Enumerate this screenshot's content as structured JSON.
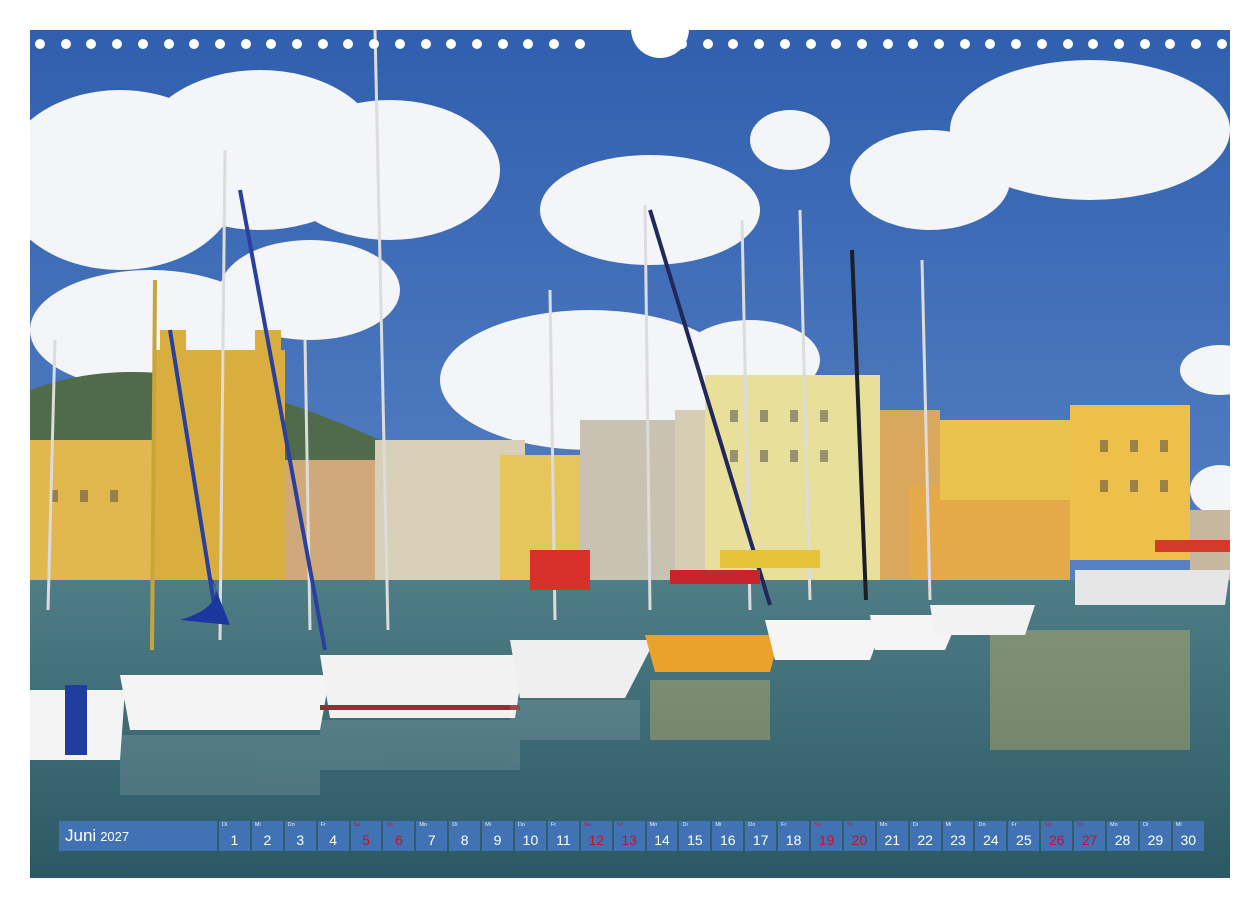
{
  "calendar": {
    "month": "Juni",
    "year": "2027",
    "days": [
      {
        "wd": "Di",
        "d": "1",
        "we": false
      },
      {
        "wd": "Mi",
        "d": "2",
        "we": false
      },
      {
        "wd": "Do",
        "d": "3",
        "we": false
      },
      {
        "wd": "Fr",
        "d": "4",
        "we": false
      },
      {
        "wd": "Sa",
        "d": "5",
        "we": true
      },
      {
        "wd": "So",
        "d": "6",
        "we": true
      },
      {
        "wd": "Mo",
        "d": "7",
        "we": false
      },
      {
        "wd": "Di",
        "d": "8",
        "we": false
      },
      {
        "wd": "Mi",
        "d": "9",
        "we": false
      },
      {
        "wd": "Do",
        "d": "10",
        "we": false
      },
      {
        "wd": "Fr",
        "d": "11",
        "we": false
      },
      {
        "wd": "Sa",
        "d": "12",
        "we": true
      },
      {
        "wd": "So",
        "d": "13",
        "we": true
      },
      {
        "wd": "Mo",
        "d": "14",
        "we": false
      },
      {
        "wd": "Di",
        "d": "15",
        "we": false
      },
      {
        "wd": "Mi",
        "d": "16",
        "we": false
      },
      {
        "wd": "Do",
        "d": "17",
        "we": false
      },
      {
        "wd": "Fr",
        "d": "18",
        "we": false
      },
      {
        "wd": "Sa",
        "d": "19",
        "we": true
      },
      {
        "wd": "So",
        "d": "20",
        "we": true
      },
      {
        "wd": "Mo",
        "d": "21",
        "we": false
      },
      {
        "wd": "Di",
        "d": "22",
        "we": false
      },
      {
        "wd": "Mi",
        "d": "23",
        "we": false
      },
      {
        "wd": "Do",
        "d": "24",
        "we": false
      },
      {
        "wd": "Fr",
        "d": "25",
        "we": false
      },
      {
        "wd": "Sa",
        "d": "26",
        "we": true
      },
      {
        "wd": "So",
        "d": "27",
        "we": true
      },
      {
        "wd": "Mo",
        "d": "28",
        "we": false
      },
      {
        "wd": "Di",
        "d": "29",
        "we": false
      },
      {
        "wd": "Mi",
        "d": "30",
        "we": false
      }
    ]
  },
  "colors": {
    "sky": "#3f6fb8",
    "water": "#3d6f78",
    "buildings": "#e2b84e",
    "strip": "#4678c8",
    "weekend": "#c8102e"
  }
}
